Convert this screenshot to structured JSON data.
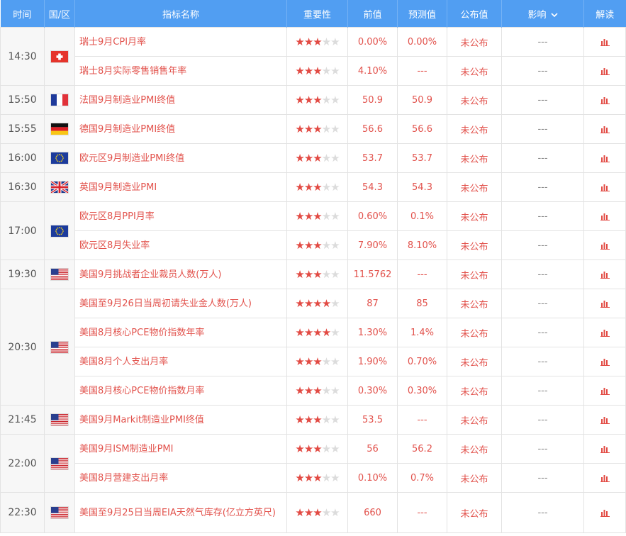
{
  "header": {
    "time": "时间",
    "country": "国/区",
    "indicator": "指标名称",
    "importance": "重要性",
    "previous": "前值",
    "forecast": "预测值",
    "actual": "公布值",
    "impact": "影响",
    "interpret": "解读"
  },
  "groups": [
    {
      "time": "14:30",
      "flag": "switzerland",
      "rows": [
        {
          "name": "瑞士9月CPI月率",
          "stars": 3,
          "previous": "0.00%",
          "forecast": "0.00%",
          "actual": "未公布",
          "impact": "---"
        },
        {
          "name": "瑞士8月实际零售销售年率",
          "stars": 3,
          "previous": "4.10%",
          "forecast": "---",
          "actual": "未公布",
          "impact": "---"
        }
      ]
    },
    {
      "time": "15:50",
      "flag": "france",
      "rows": [
        {
          "name": "法国9月制造业PMI终值",
          "stars": 3,
          "previous": "50.9",
          "forecast": "50.9",
          "actual": "未公布",
          "impact": "---"
        }
      ]
    },
    {
      "time": "15:55",
      "flag": "germany",
      "rows": [
        {
          "name": "德国9月制造业PMI终值",
          "stars": 3,
          "previous": "56.6",
          "forecast": "56.6",
          "actual": "未公布",
          "impact": "---"
        }
      ]
    },
    {
      "time": "16:00",
      "flag": "eu",
      "rows": [
        {
          "name": "欧元区9月制造业PMI终值",
          "stars": 3,
          "previous": "53.7",
          "forecast": "53.7",
          "actual": "未公布",
          "impact": "---"
        }
      ]
    },
    {
      "time": "16:30",
      "flag": "uk",
      "rows": [
        {
          "name": "英国9月制造业PMI",
          "stars": 3,
          "previous": "54.3",
          "forecast": "54.3",
          "actual": "未公布",
          "impact": "---"
        }
      ]
    },
    {
      "time": "17:00",
      "flag": "eu",
      "rows": [
        {
          "name": "欧元区8月PPI月率",
          "stars": 3,
          "previous": "0.60%",
          "forecast": "0.1%",
          "actual": "未公布",
          "impact": "---"
        },
        {
          "name": "欧元区8月失业率",
          "stars": 3,
          "previous": "7.90%",
          "forecast": "8.10%",
          "actual": "未公布",
          "impact": "---"
        }
      ]
    },
    {
      "time": "19:30",
      "flag": "us",
      "rows": [
        {
          "name": "美国9月挑战者企业裁员人数(万人)",
          "stars": 3,
          "previous": "11.5762",
          "forecast": "---",
          "actual": "未公布",
          "impact": "---"
        }
      ]
    },
    {
      "time": "20:30",
      "flag": "us",
      "rows": [
        {
          "name": "美国至9月26日当周初请失业金人数(万人)",
          "stars": 4,
          "previous": "87",
          "forecast": "85",
          "actual": "未公布",
          "impact": "---"
        },
        {
          "name": "美国8月核心PCE物价指数年率",
          "stars": 4,
          "previous": "1.30%",
          "forecast": "1.4%",
          "actual": "未公布",
          "impact": "---"
        },
        {
          "name": "美国8月个人支出月率",
          "stars": 3,
          "previous": "1.90%",
          "forecast": "0.70%",
          "actual": "未公布",
          "impact": "---"
        },
        {
          "name": "美国8月核心PCE物价指数月率",
          "stars": 3,
          "previous": "0.30%",
          "forecast": "0.30%",
          "actual": "未公布",
          "impact": "---"
        }
      ]
    },
    {
      "time": "21:45",
      "flag": "us",
      "rows": [
        {
          "name": "美国9月Markit制造业PMI终值",
          "stars": 3,
          "previous": "53.5",
          "forecast": "---",
          "actual": "未公布",
          "impact": "---"
        }
      ]
    },
    {
      "time": "22:00",
      "flag": "us",
      "rows": [
        {
          "name": "美国9月ISM制造业PMI",
          "stars": 3,
          "previous": "56",
          "forecast": "56.2",
          "actual": "未公布",
          "impact": "---"
        },
        {
          "name": "美国8月营建支出月率",
          "stars": 3,
          "previous": "0.10%",
          "forecast": "0.7%",
          "actual": "未公布",
          "impact": "---"
        }
      ]
    },
    {
      "time": "22:30",
      "flag": "us",
      "rows": [
        {
          "name": "美国至9月25日当周EIA天然气库存(亿立方英尺)",
          "stars": 3,
          "previous": "660",
          "forecast": "---",
          "actual": "未公布",
          "impact": "---",
          "tall": true
        }
      ]
    }
  ],
  "colors": {
    "header_bg": "#519ef2",
    "accent_red": "#e24a43",
    "star_off": "#dcdcdc"
  },
  "icons": {
    "impact_dropdown": "chevron-down-icon",
    "interpret": "bar-chart-icon"
  }
}
